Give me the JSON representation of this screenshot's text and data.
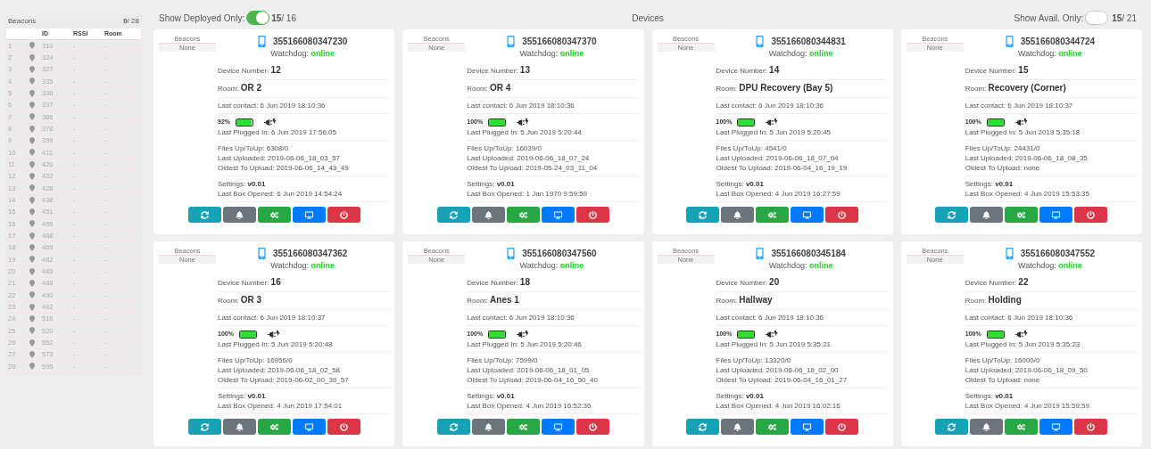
{
  "beacons_panel": {
    "title": "Beacons",
    "count": "**0**/ 28",
    "columns": [
      "ID",
      "RSSI",
      "Room"
    ],
    "rows": [
      {
        "index": "1",
        "id": "310",
        "rssi": "-",
        "room": "-"
      },
      {
        "index": "2",
        "id": "324",
        "rssi": "-",
        "room": "-"
      },
      {
        "index": "3",
        "id": "327",
        "rssi": "-",
        "room": "-"
      },
      {
        "index": "4",
        "id": "335",
        "rssi": "-",
        "room": "-"
      },
      {
        "index": "5",
        "id": "336",
        "rssi": "-",
        "room": "-"
      },
      {
        "index": "6",
        "id": "337",
        "rssi": "-",
        "room": "-"
      },
      {
        "index": "7",
        "id": "366",
        "rssi": "-",
        "room": "-"
      },
      {
        "index": "8",
        "id": "378",
        "rssi": "-",
        "room": "-"
      },
      {
        "index": "9",
        "id": "399",
        "rssi": "-",
        "room": "-"
      },
      {
        "index": "10",
        "id": "411",
        "rssi": "-",
        "room": "-"
      },
      {
        "index": "11",
        "id": "420",
        "rssi": "-",
        "room": "-"
      },
      {
        "index": "12",
        "id": "422",
        "rssi": "-",
        "room": "-"
      },
      {
        "index": "13",
        "id": "428",
        "rssi": "-",
        "room": "-"
      },
      {
        "index": "14",
        "id": "438",
        "rssi": "-",
        "room": "-"
      },
      {
        "index": "15",
        "id": "451",
        "rssi": "-",
        "room": "-"
      },
      {
        "index": "16",
        "id": "455",
        "rssi": "-",
        "room": "-"
      },
      {
        "index": "17",
        "id": "468",
        "rssi": "-",
        "room": "-"
      },
      {
        "index": "18",
        "id": "469",
        "rssi": "-",
        "room": "-"
      },
      {
        "index": "19",
        "id": "482",
        "rssi": "-",
        "room": "-"
      },
      {
        "index": "20",
        "id": "485",
        "rssi": "-",
        "room": "-"
      },
      {
        "index": "21",
        "id": "488",
        "rssi": "-",
        "room": "-"
      },
      {
        "index": "22",
        "id": "490",
        "rssi": "-",
        "room": "-"
      },
      {
        "index": "23",
        "id": "492",
        "rssi": "-",
        "room": "-"
      },
      {
        "index": "24",
        "id": "516",
        "rssi": "-",
        "room": "-"
      },
      {
        "index": "25",
        "id": "520",
        "rssi": "-",
        "room": "-"
      },
      {
        "index": "26",
        "id": "552",
        "rssi": "-",
        "room": "-"
      },
      {
        "index": "27",
        "id": "573",
        "rssi": "-",
        "room": "-"
      },
      {
        "index": "28",
        "id": "595",
        "rssi": "-",
        "room": "-"
      }
    ]
  },
  "header": {
    "deployed_label": "Show Deployed Only:",
    "deployed_on": true,
    "deployed_count": "**15**/ 16",
    "title": "Devices",
    "avail_label": "Show Avail. Only:",
    "avail_on": false,
    "avail_count": "**15**/ 21"
  },
  "devices": [
    {
      "beacons_label": "Beacons",
      "beacons_value": "None",
      "imei": "355166080347230",
      "watchdog_label": "Watchdog:",
      "watchdog_status": "online",
      "sections": [
        [
          {
            "kind": "big",
            "label": "Device Number:",
            "value": "12"
          }
        ],
        [
          {
            "kind": "big",
            "label": "Room:",
            "value": "OR 2"
          }
        ],
        [
          {
            "kind": "plain",
            "label": "Last contact:",
            "value": "6 Jun 2019 18:10:36"
          }
        ],
        [
          {
            "kind": "battery",
            "value": "92%",
            "level": 0.92
          },
          {
            "kind": "plain",
            "label": "Last Plugged In:",
            "value": "6 Jun 2019 17:56:05"
          }
        ],
        [
          {
            "kind": "plain",
            "label": "Files Up/ToUp:",
            "value": "6308/0"
          },
          {
            "kind": "plain",
            "label": "Last Uploaded:",
            "value": "2019-06-06_18_03_57"
          },
          {
            "kind": "plain",
            "label": "Oldest To Upload:",
            "value": "2019-06-06_14_43_49"
          }
        ],
        [
          {
            "kind": "bold",
            "label": "Settings:",
            "value": "v0.01"
          },
          {
            "kind": "plain",
            "label": "Last Box Opened:",
            "value": "6 Jun 2019 14:54:24"
          }
        ]
      ]
    },
    {
      "beacons_label": "Beacons",
      "beacons_value": "None",
      "imei": "355166080347370",
      "watchdog_label": "Watchdog:",
      "watchdog_status": "online",
      "sections": [
        [
          {
            "kind": "big",
            "label": "Device Number:",
            "value": "13"
          }
        ],
        [
          {
            "kind": "big",
            "label": "Room:",
            "value": "OR 4"
          }
        ],
        [
          {
            "kind": "plain",
            "label": "Last contact:",
            "value": "6 Jun 2019 18:10:36"
          }
        ],
        [
          {
            "kind": "battery",
            "value": "100%",
            "level": 1
          },
          {
            "kind": "plain",
            "label": "Last Plugged In:",
            "value": "5 Jun 2019 5:20:44"
          }
        ],
        [
          {
            "kind": "plain",
            "label": "Files Up/ToUp:",
            "value": "16039/0"
          },
          {
            "kind": "plain",
            "label": "Last Uploaded:",
            "value": "2019-06-06_18_07_24"
          },
          {
            "kind": "plain",
            "label": "Oldest To Upload:",
            "value": "2019-05-24_03_11_04"
          }
        ],
        [
          {
            "kind": "bold",
            "label": "Settings:",
            "value": "v0.01"
          },
          {
            "kind": "plain",
            "label": "Last Box Opened:",
            "value": "1 Jan 1970 9:59:59"
          }
        ]
      ]
    },
    {
      "beacons_label": "Beacons",
      "beacons_value": "None",
      "imei": "355166080344831",
      "watchdog_label": "Watchdog:",
      "watchdog_status": "online",
      "sections": [
        [
          {
            "kind": "big",
            "label": "Device Number:",
            "value": "14"
          }
        ],
        [
          {
            "kind": "big",
            "label": "Room:",
            "value": "DPU Recovery (Bay 5)"
          }
        ],
        [
          {
            "kind": "plain",
            "label": "Last contact:",
            "value": "6 Jun 2019 18:10:36"
          }
        ],
        [
          {
            "kind": "battery",
            "value": "100%",
            "level": 1
          },
          {
            "kind": "plain",
            "label": "Last Plugged In:",
            "value": "5 Jun 2019 5:20:45"
          }
        ],
        [
          {
            "kind": "plain",
            "label": "Files Up/ToUp:",
            "value": "4541/0"
          },
          {
            "kind": "plain",
            "label": "Last Uploaded:",
            "value": "2019-06-06_18_07_04"
          },
          {
            "kind": "plain",
            "label": "Oldest To Upload:",
            "value": "2019-06-04_16_19_19"
          }
        ],
        [
          {
            "kind": "bold",
            "label": "Settings:",
            "value": "v0.01"
          },
          {
            "kind": "plain",
            "label": "Last Box Opened:",
            "value": "4 Jun 2019 16:27:59"
          }
        ]
      ]
    },
    {
      "beacons_label": "Beacons",
      "beacons_value": "None",
      "imei": "355166080344724",
      "watchdog_label": "Watchdog:",
      "watchdog_status": "online",
      "sections": [
        [
          {
            "kind": "big",
            "label": "Device Number:",
            "value": "15"
          }
        ],
        [
          {
            "kind": "big",
            "label": "Room:",
            "value": "Recovery (Corner)"
          }
        ],
        [
          {
            "kind": "plain",
            "label": "Last contact:",
            "value": "6 Jun 2019 18:10:37"
          }
        ],
        [
          {
            "kind": "battery",
            "value": "100%",
            "level": 1
          },
          {
            "kind": "plain",
            "label": "Last Plugged In:",
            "value": "5 Jun 2019 5:35:18"
          }
        ],
        [
          {
            "kind": "plain",
            "label": "Files Up/ToUp:",
            "value": "24431/0"
          },
          {
            "kind": "plain",
            "label": "Last Uploaded:",
            "value": "2019-06-06_18_08_35"
          },
          {
            "kind": "plain",
            "label": "Oldest To Upload:",
            "value": "none"
          }
        ],
        [
          {
            "kind": "bold",
            "label": "Settings:",
            "value": "v0.01"
          },
          {
            "kind": "plain",
            "label": "Last Box Opened:",
            "value": "4 Jun 2019 15:53:35"
          }
        ]
      ]
    },
    {
      "beacons_label": "Beacons",
      "beacons_value": "None",
      "imei": "355166080347362",
      "watchdog_label": "Watchdog:",
      "watchdog_status": "online",
      "sections": [
        [
          {
            "kind": "big",
            "label": "Device Number:",
            "value": "16"
          }
        ],
        [
          {
            "kind": "big",
            "label": "Room:",
            "value": "OR 3"
          }
        ],
        [
          {
            "kind": "plain",
            "label": "Last contact:",
            "value": "6 Jun 2019 18:10:37"
          }
        ],
        [
          {
            "kind": "battery",
            "value": "100%",
            "level": 1
          },
          {
            "kind": "plain",
            "label": "Last Plugged In:",
            "value": "5 Jun 2019 5:20:48"
          }
        ],
        [
          {
            "kind": "plain",
            "label": "Files Up/ToUp:",
            "value": "16956/0"
          },
          {
            "kind": "plain",
            "label": "Last Uploaded:",
            "value": "2019-06-06_18_02_58"
          },
          {
            "kind": "plain",
            "label": "Oldest To Upload:",
            "value": "2019-06-02_00_39_57"
          }
        ],
        [
          {
            "kind": "bold",
            "label": "Settings:",
            "value": "v0.01"
          },
          {
            "kind": "plain",
            "label": "Last Box Opened:",
            "value": "4 Jun 2019 17:54:01"
          }
        ]
      ]
    },
    {
      "beacons_label": "Beacons",
      "beacons_value": "None",
      "imei": "355166080347560",
      "watchdog_label": "Watchdog:",
      "watchdog_status": "online",
      "sections": [
        [
          {
            "kind": "big",
            "label": "Device Number:",
            "value": "18"
          }
        ],
        [
          {
            "kind": "big",
            "label": "Room:",
            "value": "Anes 1"
          }
        ],
        [
          {
            "kind": "plain",
            "label": "Last contact:",
            "value": "6 Jun 2019 18:10:36"
          }
        ],
        [
          {
            "kind": "battery",
            "value": "100%",
            "level": 1
          },
          {
            "kind": "plain",
            "label": "Last Plugged In:",
            "value": "5 Jun 2019 5:20:46"
          }
        ],
        [
          {
            "kind": "plain",
            "label": "Files Up/ToUp:",
            "value": "7599/0"
          },
          {
            "kind": "plain",
            "label": "Last Uploaded:",
            "value": "2019-06-06_18_01_05"
          },
          {
            "kind": "plain",
            "label": "Oldest To Upload:",
            "value": "2019-06-04_16_50_40"
          }
        ],
        [
          {
            "kind": "bold",
            "label": "Settings:",
            "value": "v0.01"
          },
          {
            "kind": "plain",
            "label": "Last Box Opened:",
            "value": "4 Jun 2019 16:52:36"
          }
        ]
      ]
    },
    {
      "beacons_label": "Beacons",
      "beacons_value": "None",
      "imei": "355166080345184",
      "watchdog_label": "Watchdog:",
      "watchdog_status": "online",
      "sections": [
        [
          {
            "kind": "big",
            "label": "Device Number:",
            "value": "20"
          }
        ],
        [
          {
            "kind": "big",
            "label": "Room:",
            "value": "Hallway"
          }
        ],
        [
          {
            "kind": "plain",
            "label": "Last contact:",
            "value": "6 Jun 2019 18:10:36"
          }
        ],
        [
          {
            "kind": "battery",
            "value": "100%",
            "level": 1
          },
          {
            "kind": "plain",
            "label": "Last Plugged In:",
            "value": "5 Jun 2019 5:35:21"
          }
        ],
        [
          {
            "kind": "plain",
            "label": "Files Up/ToUp:",
            "value": "13320/0"
          },
          {
            "kind": "plain",
            "label": "Last Uploaded:",
            "value": "2019-06-06_18_02_00"
          },
          {
            "kind": "plain",
            "label": "Oldest To Upload:",
            "value": "2019-06-04_16_01_27"
          }
        ],
        [
          {
            "kind": "bold",
            "label": "Settings:",
            "value": "v0.01"
          },
          {
            "kind": "plain",
            "label": "Last Box Opened:",
            "value": "4 Jun 2019 16:02:16"
          }
        ]
      ]
    },
    {
      "beacons_label": "Beacons",
      "beacons_value": "None",
      "imei": "355166080347552",
      "watchdog_label": "Watchdog:",
      "watchdog_status": "online",
      "sections": [
        [
          {
            "kind": "big",
            "label": "Device Number:",
            "value": "22"
          }
        ],
        [
          {
            "kind": "big",
            "label": "Room:",
            "value": "Holding"
          }
        ],
        [
          {
            "kind": "plain",
            "label": "Last contact:",
            "value": "6 Jun 2019 18:10:36"
          }
        ],
        [
          {
            "kind": "battery",
            "value": "100%",
            "level": 1
          },
          {
            "kind": "plain",
            "label": "Last Plugged In:",
            "value": "5 Jun 2019 5:35:23"
          }
        ],
        [
          {
            "kind": "plain",
            "label": "Files Up/ToUp:",
            "value": "16000/0"
          },
          {
            "kind": "plain",
            "label": "Last Uploaded:",
            "value": "2019-06-06_18_09_50"
          },
          {
            "kind": "plain",
            "label": "Oldest To Upload:",
            "value": "none"
          }
        ],
        [
          {
            "kind": "bold",
            "label": "Settings:",
            "value": "v0.01"
          },
          {
            "kind": "plain",
            "label": "Last Box Opened:",
            "value": "4 Jun 2019 15:59:59"
          }
        ]
      ]
    }
  ]
}
